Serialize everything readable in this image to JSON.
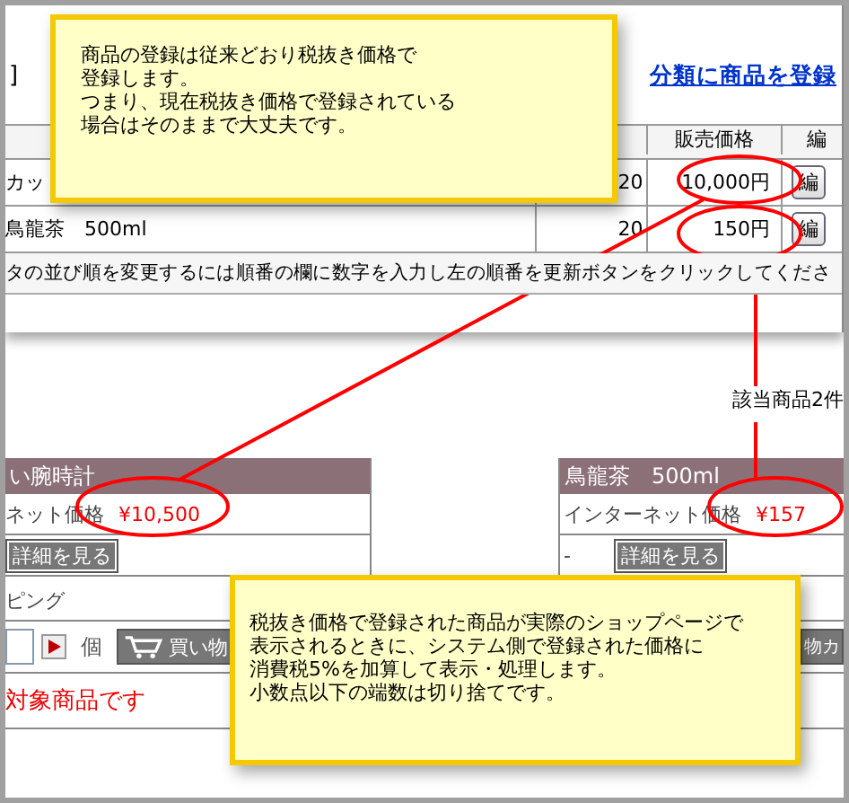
{
  "admin": {
    "bracket": "]",
    "category_link": "分類に商品を登録",
    "columns": [
      {},
      {},
      {
        "label": "販売価格"
      },
      {
        "label": "編"
      }
    ],
    "rows": [
      {
        "name": "カッ",
        "count": "20",
        "price": "10,000円",
        "edit": "編",
        "highlighted": true
      },
      {
        "name": "鳥龍茶　500ml",
        "count": "20",
        "price": "150円",
        "edit": "編",
        "highlighted": true
      }
    ],
    "note": "タの並び順を変更するには順番の欄に数字を入力し左の順番を更新ボタンをクリックしてくださ"
  },
  "shop": {
    "result_count": "該当商品2件",
    "products": [
      {
        "title": "い腕時計",
        "price_label": "ネット価格",
        "price": "¥10,500",
        "detail_button": "詳細を見る",
        "highlighted": true
      },
      {
        "title": "鳥龍茶　500ml",
        "price_label": "インターネット価格",
        "price": "¥157",
        "stock": "-",
        "detail_button": "詳細を見る",
        "highlighted": true
      }
    ],
    "shipping_label": "ピング",
    "unit": "個",
    "cart_buttons": [
      "買い物",
      "物カ"
    ],
    "notice": "対象商品です"
  },
  "callouts": [
    {
      "lines": [
        "商品の登録は従来どおり税抜き価格で",
        "登録します。",
        "つまり、現在税抜き価格で登録されている",
        "場合はそのままで大丈夫です。"
      ]
    },
    {
      "lines": [
        "税抜き価格で登録された商品が実際のショップページで",
        "表示されるときに、システム側で登録された価格に",
        "消費税5%を加算して表示・処理します。",
        "小数点以下の端数は切り捨てです。"
      ]
    }
  ]
}
